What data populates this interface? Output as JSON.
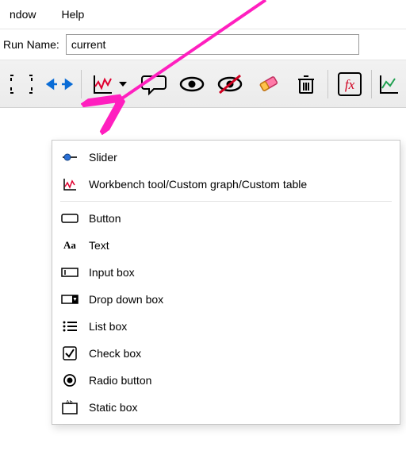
{
  "menubar": {
    "items": [
      "ndow",
      "Help"
    ]
  },
  "runbar": {
    "label": "Run Name:",
    "value": "current"
  },
  "toolbar": {
    "buttons": [
      "select-brackets",
      "fit-horizontal",
      "graph-dropdown",
      "comment",
      "eye-show",
      "eye-hide",
      "eraser",
      "trash",
      "fx-function",
      "graph-axes"
    ]
  },
  "dropdown": {
    "items": [
      {
        "icon": "slider",
        "label": "Slider"
      },
      {
        "icon": "graph",
        "label": "Workbench tool/Custom graph/Custom table"
      },
      {
        "icon": "button",
        "label": "Button"
      },
      {
        "icon": "text",
        "label": "Text"
      },
      {
        "icon": "input",
        "label": "Input box"
      },
      {
        "icon": "select",
        "label": "Drop down box"
      },
      {
        "icon": "list",
        "label": "List box"
      },
      {
        "icon": "check",
        "label": "Check box"
      },
      {
        "icon": "radio",
        "label": "Radio button"
      },
      {
        "icon": "static",
        "label": "Static box"
      }
    ]
  }
}
